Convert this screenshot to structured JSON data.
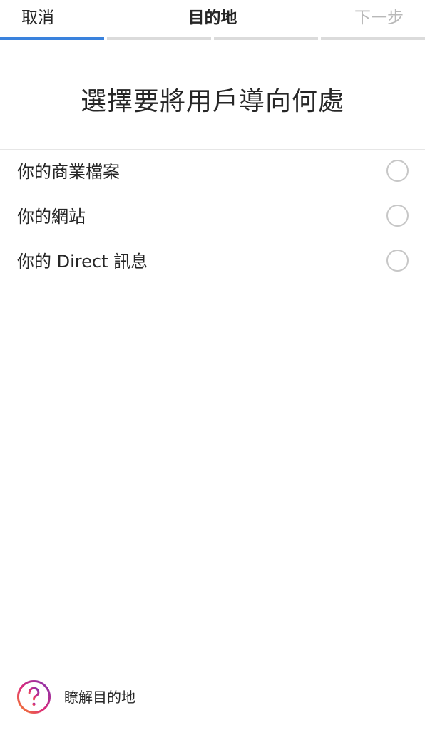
{
  "nav": {
    "cancel_label": "取消",
    "title": "目的地",
    "next_label": "下一步"
  },
  "progress": {
    "total_steps": 4,
    "current_step": 1,
    "active_color": "#3a82dd",
    "inactive_color": "#dbdbdb"
  },
  "heading": "選擇要將用戶導向何處",
  "options": [
    {
      "label": "你的商業檔案",
      "selected": false
    },
    {
      "label": "你的網站",
      "selected": false
    },
    {
      "label": "你的 Direct 訊息",
      "selected": false
    }
  ],
  "help": {
    "icon": "question-mark-icon",
    "label": "瞭解目的地"
  }
}
